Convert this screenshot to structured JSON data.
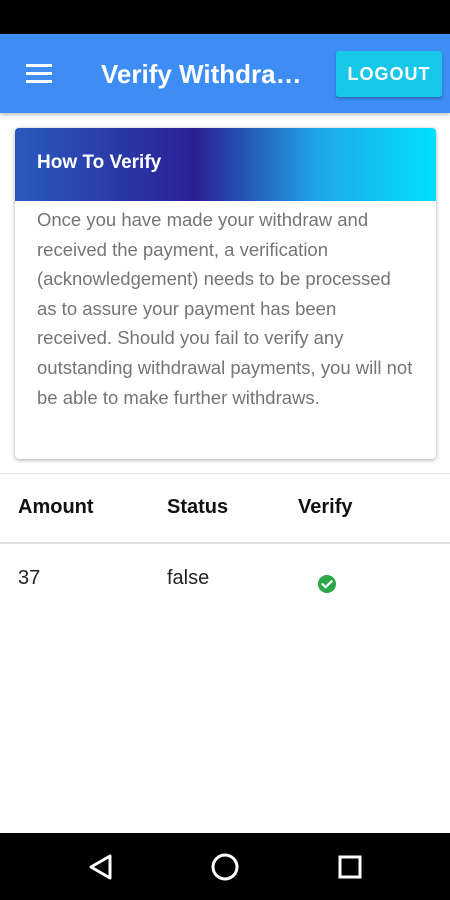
{
  "app_bar": {
    "title": "Verify Withdrawals",
    "logout_label": "LOGOUT",
    "color": "#3d8df5",
    "logout_color": "#17c7e8"
  },
  "info_card": {
    "title": "How To Verify",
    "body": "Once you have made your withdraw and received the payment, a verification (acknowledgement) needs to be processed as to assure your payment has been received. Should you fail to verify any outstanding withdrawal payments, you will not be able to make further withdraws."
  },
  "table": {
    "headers": [
      "Amount",
      "Status",
      "Verify"
    ],
    "rows": [
      {
        "amount": "37",
        "status": "false",
        "verify_icon": "check-circle-icon",
        "verify_color": "#2aa84a"
      }
    ]
  },
  "nav": {
    "icons": [
      "back-triangle-icon",
      "home-circle-icon",
      "recents-square-icon"
    ]
  }
}
